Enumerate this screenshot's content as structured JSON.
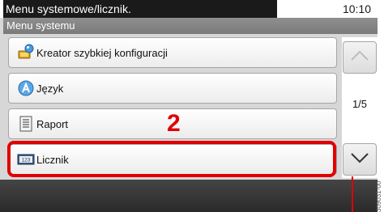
{
  "header": {
    "title": "Menu systemowe/licznik.",
    "clock": "10:10",
    "subtitle": "Menu systemu"
  },
  "menu": {
    "items": [
      {
        "label": "Kreator szybkiej konfiguracji",
        "icon": "wizard-icon"
      },
      {
        "label": "Język",
        "icon": "language-icon"
      },
      {
        "label": "Raport",
        "icon": "report-icon"
      },
      {
        "label": "Licznik",
        "icon": "counter-icon"
      }
    ]
  },
  "annotation": {
    "step_number": "2",
    "highlight_color": "#e10000"
  },
  "pager": {
    "page": "1/5"
  },
  "side_code": "309031-00"
}
